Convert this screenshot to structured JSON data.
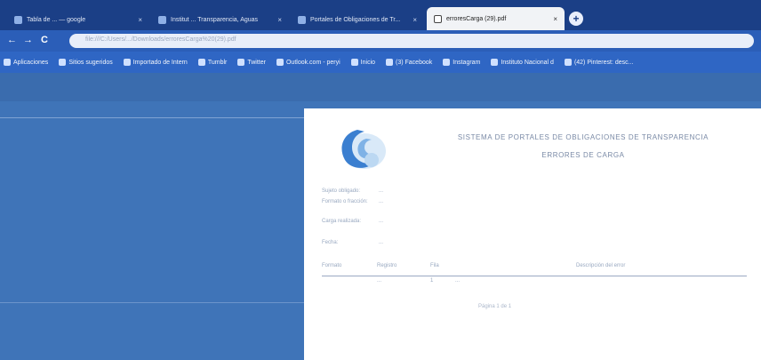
{
  "browser": {
    "tabs": [
      {
        "label": "Tabla de ... — google",
        "active": false
      },
      {
        "label": "Institut ... Transparencia, Aguas",
        "active": false
      },
      {
        "label": "Portales de Obligaciones de Tr...",
        "active": false
      },
      {
        "label": "erroresCarga (29).pdf",
        "active": true
      }
    ],
    "newtab_symbol": "+",
    "tab_close_symbol": "×",
    "nav": {
      "back": "←",
      "forward": "→",
      "reload": "C"
    },
    "url": "file:///C:/Users/.../Downloads/erroresCarga%20(29).pdf",
    "bookmarks": [
      {
        "label": "Aplicaciones"
      },
      {
        "label": "Sitios sugeridos"
      },
      {
        "label": "Importado de Intern"
      },
      {
        "label": "Tumblr"
      },
      {
        "label": "Twitter"
      },
      {
        "label": "Outlook.com - peryi"
      },
      {
        "label": "Inicio"
      },
      {
        "label": "(3) Facebook"
      },
      {
        "label": "Instagram"
      },
      {
        "label": "Instituto Nacional d"
      },
      {
        "label": "(42) Pinterest: desc..."
      }
    ]
  },
  "pdf": {
    "title": "SISTEMA DE PORTALES DE OBLIGACIONES DE TRANSPARENCIA",
    "subtitle": "ERRORES DE CARGA",
    "fields": [
      {
        "label": "Sujeto obligado:",
        "value": "..."
      },
      {
        "label": "Formato o fracción:",
        "value": "..."
      },
      {
        "label": "Carga realizada:",
        "value": "..."
      },
      {
        "label": "Fecha:",
        "value": "..."
      }
    ],
    "table": {
      "headers": [
        "Formato",
        "Registro",
        "Fila",
        "Descripción del error"
      ],
      "rows": [
        [
          "",
          "...",
          "1",
          "..."
        ]
      ]
    },
    "footer": "Página 1 de 1"
  },
  "colors": {
    "tabstrip": "#1b3f86",
    "toolbar": "#2b5eb8",
    "bookmarks_bar": "#2f66c4",
    "viewer_background": "#3f74b8",
    "page": "#ffffff",
    "logo_blue": "#3b7fd0"
  }
}
